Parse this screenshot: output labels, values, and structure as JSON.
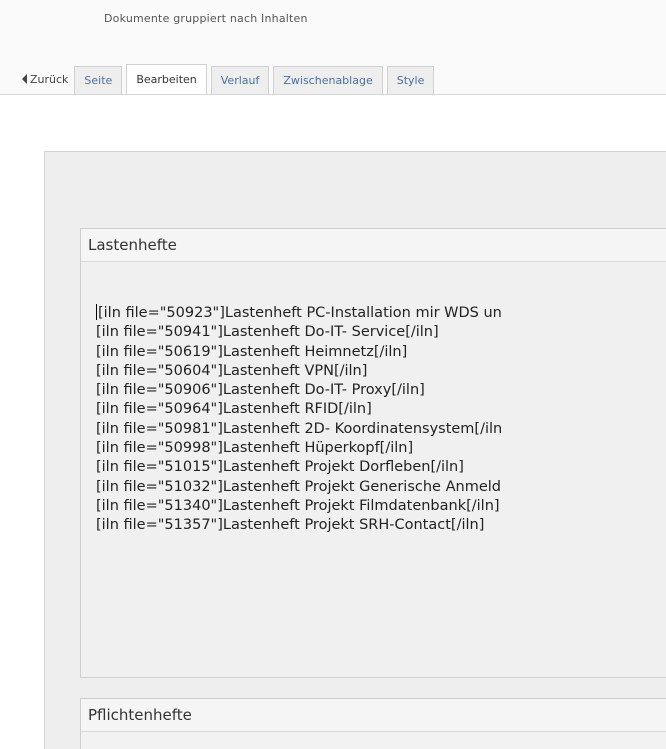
{
  "header": {
    "subtitle": "Dokumente gruppiert nach Inhalten"
  },
  "toolbar": {
    "back_label": "Zurück",
    "tabs": [
      {
        "label": "Seite",
        "active": false
      },
      {
        "label": "Bearbeiten",
        "active": true
      },
      {
        "label": "Verlauf",
        "active": false
      },
      {
        "label": "Zwischenablage",
        "active": false
      },
      {
        "label": "Style",
        "active": false
      }
    ]
  },
  "groups": {
    "lastenhefte": {
      "title": "Lastenhefte",
      "lines": [
        "[iln file=\"50923\"]Lastenheft PC-Installation mir WDS un",
        "[iln file=\"50941\"]Lastenheft Do-IT- Service[/iln]",
        "[iln file=\"50619\"]Lastenheft Heimnetz[/iln]",
        "[iln file=\"50604\"]Lastenheft VPN[/iln]",
        "[iln file=\"50906\"]Lastenheft Do-IT- Proxy[/iln]",
        "[iln file=\"50964\"]Lastenheft RFID[/iln]",
        "[iln file=\"50981\"]Lastenheft 2D- Koordinatensystem[/iln",
        "[iln file=\"50998\"]Lastenheft Hüperkopf[/iln]",
        "[iln file=\"51015\"]Lastenheft Projekt Dorfleben[/iln]",
        "[iln file=\"51032\"]Lastenheft Projekt Generische Anmeld",
        "[iln file=\"51340\"]Lastenheft Projekt Filmdatenbank[/iln]",
        "[iln file=\"51357\"]Lastenheft Projekt SRH-Contact[/iln]"
      ]
    },
    "pflichtenhefte": {
      "title": "Pflichtenhefte"
    }
  }
}
